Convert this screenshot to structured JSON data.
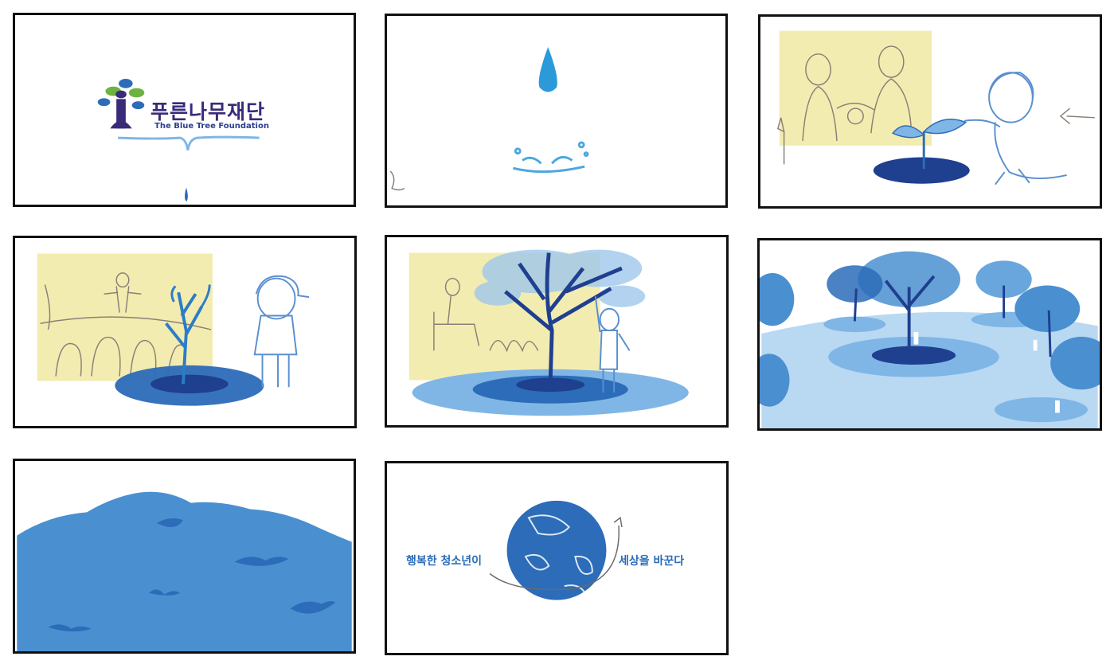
{
  "logo": {
    "korean_name": "푸른나무재단",
    "english_name": "The Blue Tree Foundation"
  },
  "closing": {
    "slogan_left": "행복한 청소년이",
    "slogan_right": "세상을 바꾼다"
  },
  "colors": {
    "blue_dark": "#1f3f8f",
    "blue_mid": "#2c6cb8",
    "blue_light": "#7fb6e6",
    "sky": "#b9d8f2",
    "yellow": "#f3ecb0",
    "pencil": "#8a7f78",
    "logo_purple": "#3a2a7a",
    "logo_green": "#6db33f"
  }
}
